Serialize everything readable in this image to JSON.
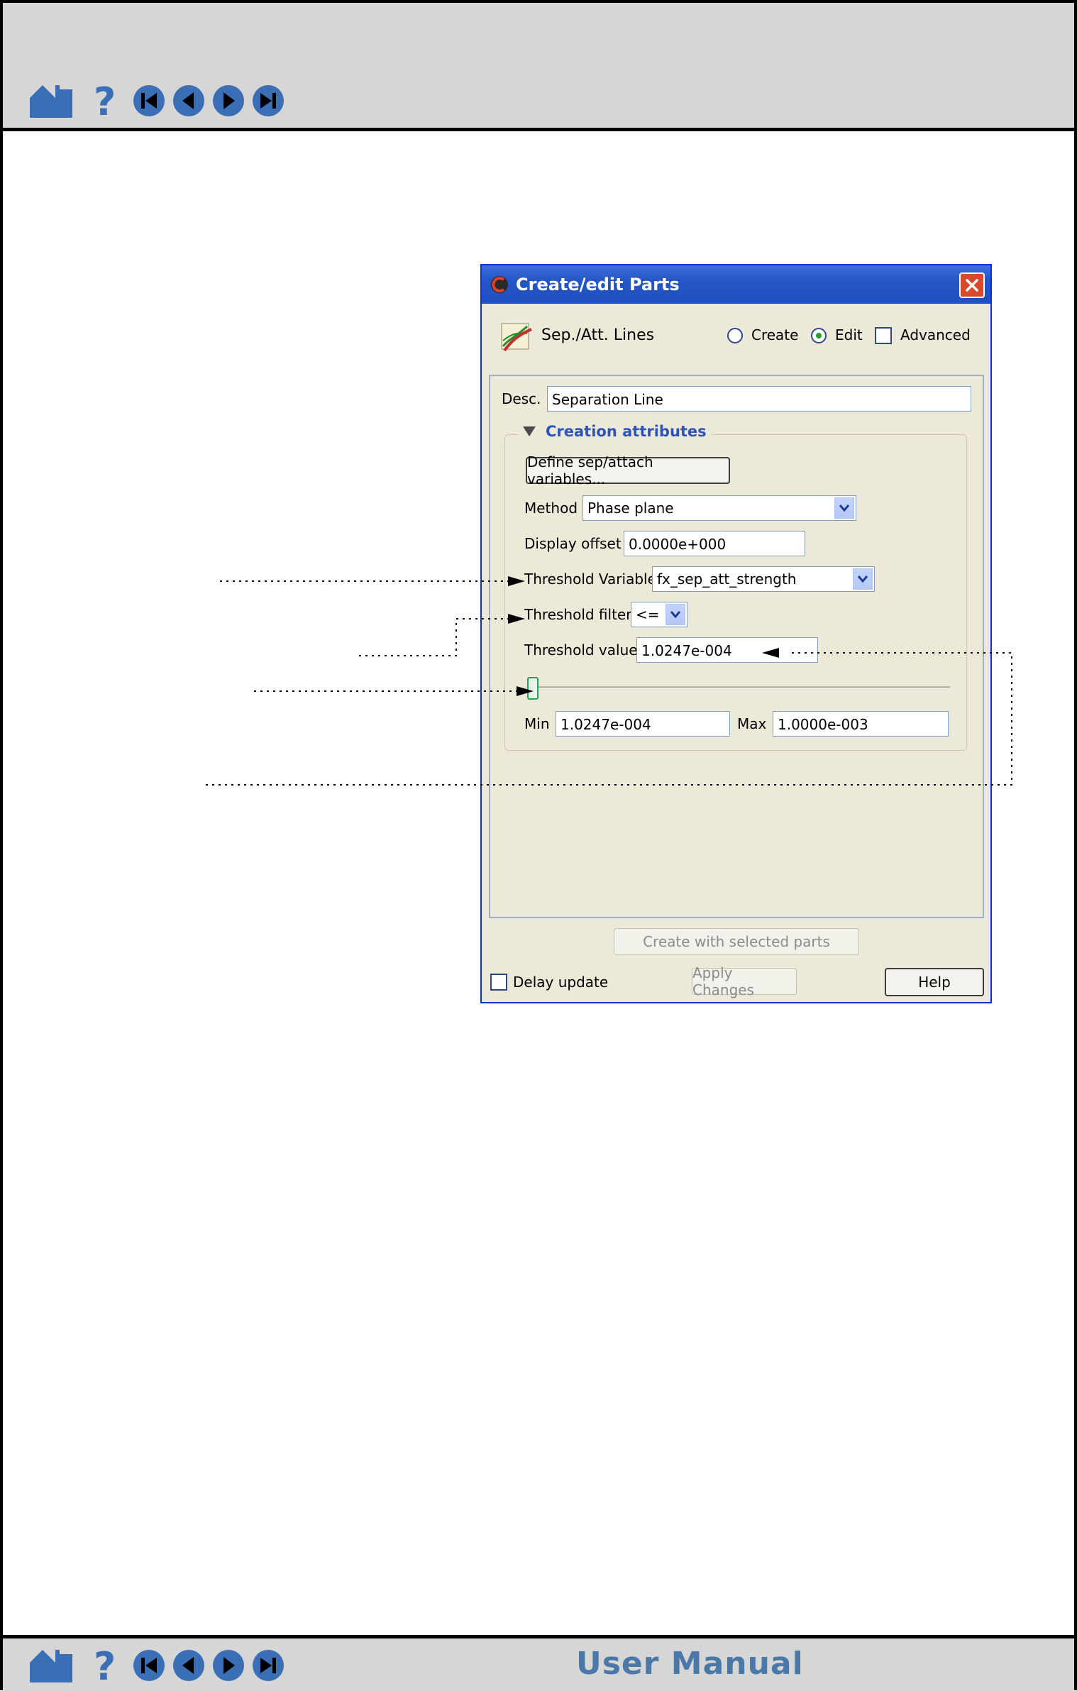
{
  "manual": {
    "title": "User Manual"
  },
  "icons": {
    "home": "home-icon",
    "help": "help-icon",
    "first": "first-page-icon",
    "prev": "previous-page-icon",
    "next": "next-page-icon",
    "last": "last-page-icon"
  },
  "colors": {
    "nav_blue": "#3b6fb5",
    "title_blue": "#2456c7",
    "group_title": "#2e54b8",
    "thumb": "#2f9e55"
  },
  "dialog": {
    "title": "Create/edit Parts",
    "part_type": "Sep./Att. Lines",
    "mode": {
      "create_label": "Create",
      "edit_label": "Edit",
      "selected": "Edit"
    },
    "advanced_label": "Advanced",
    "desc_label": "Desc.",
    "desc_value": "Separation Line",
    "group_title": "Creation attributes",
    "define_button": "Define sep/attach variables...",
    "method_label": "Method",
    "method_value": "Phase plane",
    "offset_label": "Display offset",
    "offset_value": "0.0000e+000",
    "threshold_variable_label": "Threshold Variable",
    "threshold_variable_value": "fx_sep_att_strength",
    "threshold_filter_label": "Threshold filter",
    "threshold_filter_value": "<=",
    "threshold_value_label": "Threshold value",
    "threshold_value": "1.0247e-004",
    "min_label": "Min",
    "min_value": "1.0247e-004",
    "max_label": "Max",
    "max_value": "1.0000e-003",
    "slider_fraction": 0.0,
    "create_selected_button": "Create with selected parts",
    "delay_update_label": "Delay update",
    "apply_button": "Apply Changes",
    "help_button": "Help"
  }
}
